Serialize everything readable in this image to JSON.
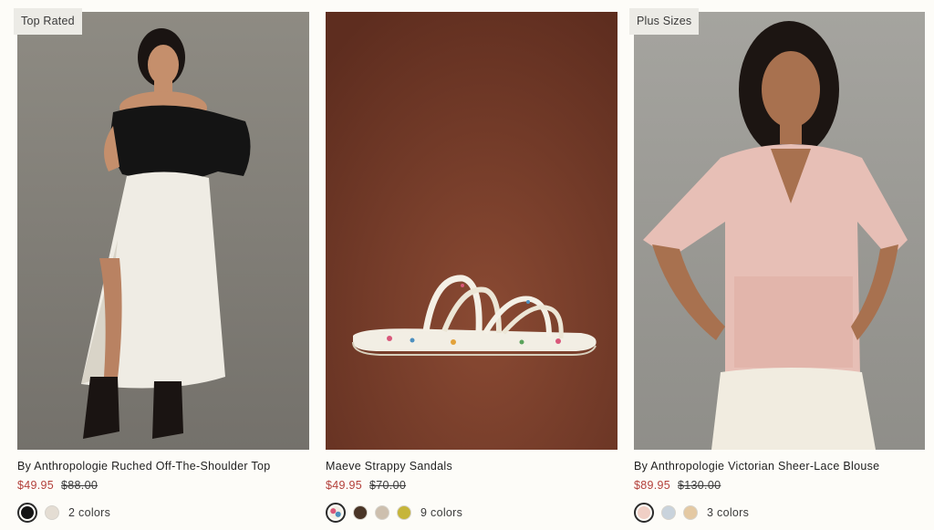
{
  "products": [
    {
      "badge": "Top Rated",
      "title": "By Anthropologie Ruched Off-The-Shoulder Top",
      "sale_price": "$49.95",
      "original_price": "$88.00",
      "colors_label": "2 colors",
      "swatches": [
        "#151515",
        "#e4ddd3"
      ]
    },
    {
      "badge": "",
      "title": "Maeve Strappy Sandals",
      "sale_price": "$49.95",
      "original_price": "$70.00",
      "colors_label": "9 colors",
      "swatches": [
        "floral",
        "#4a3527",
        "#cdbfae",
        "#c6b53a"
      ]
    },
    {
      "badge": "Plus Sizes",
      "title": "By Anthropologie Victorian Sheer-Lace Blouse",
      "sale_price": "$89.95",
      "original_price": "$130.00",
      "colors_label": "3 colors",
      "swatches": [
        "#f0cfc5",
        "#c9d3dc",
        "#e4c9a3"
      ]
    }
  ]
}
